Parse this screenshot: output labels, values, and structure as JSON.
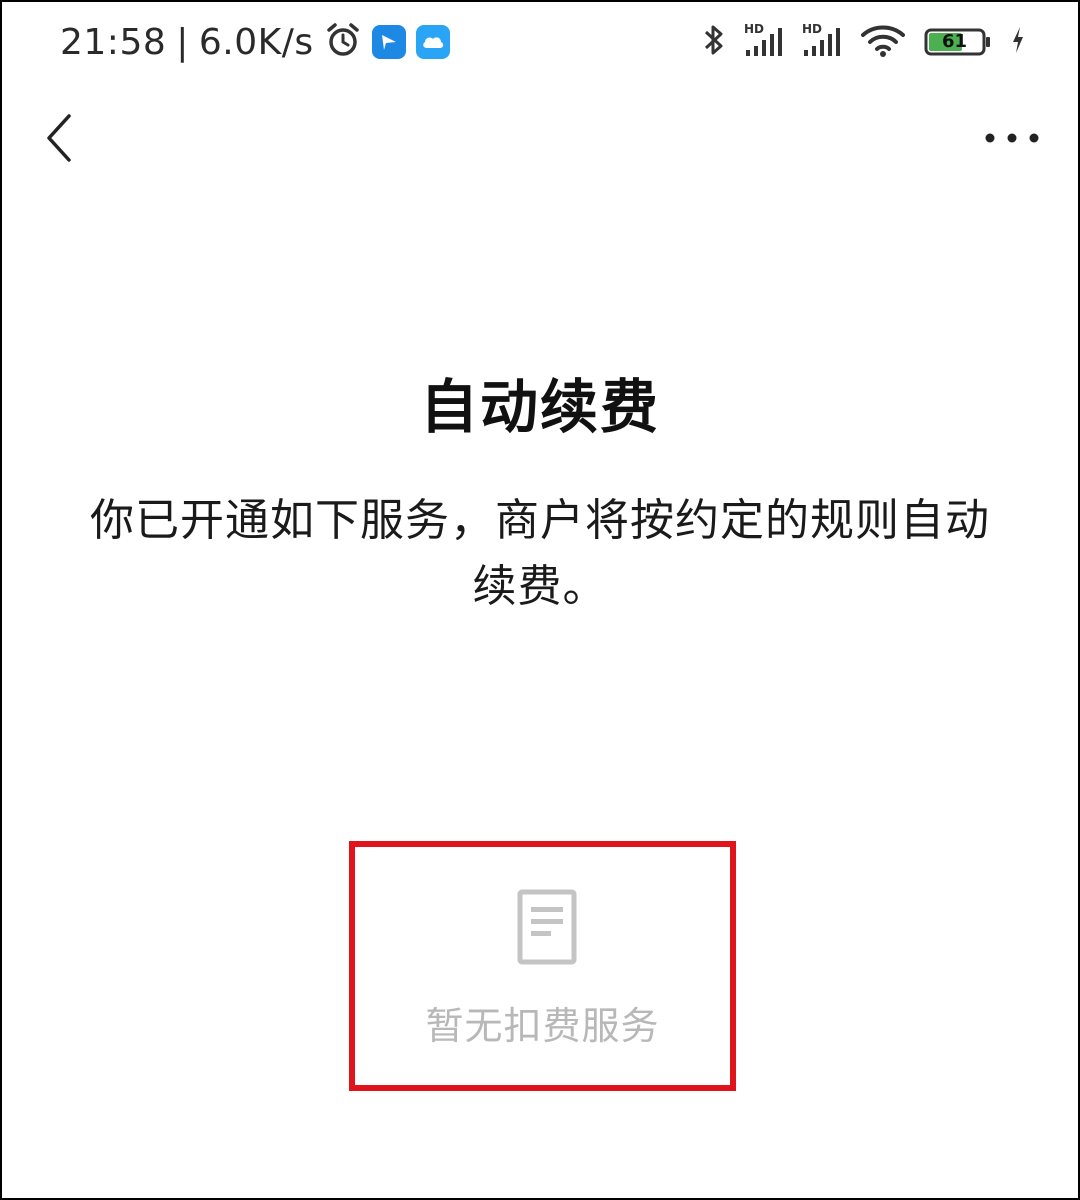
{
  "status_bar": {
    "time": "21:58",
    "separator": "|",
    "network_speed": "6.0K/s",
    "left_icons": [
      "alarm-icon",
      "app-notification-icon",
      "cloud-app-icon"
    ],
    "right_icons": [
      "bluetooth-icon",
      "hd-signal-icon",
      "hd-signal-icon",
      "wifi-icon",
      "battery-icon",
      "charging-icon"
    ],
    "signal_label_1": "HD",
    "signal_label_2": "HD",
    "battery_level": "61",
    "battery_color": "#4caf50"
  },
  "nav": {
    "back_icon": "chevron-left-icon",
    "more_icon": "more-horizontal-icon"
  },
  "main": {
    "title": "自动续费",
    "description": "你已开通如下服务，商户将按约定的规则自动续费。",
    "empty_state": {
      "icon": "document-icon",
      "text": "暂无扣费服务",
      "highlight_color": "#e0141a"
    }
  }
}
